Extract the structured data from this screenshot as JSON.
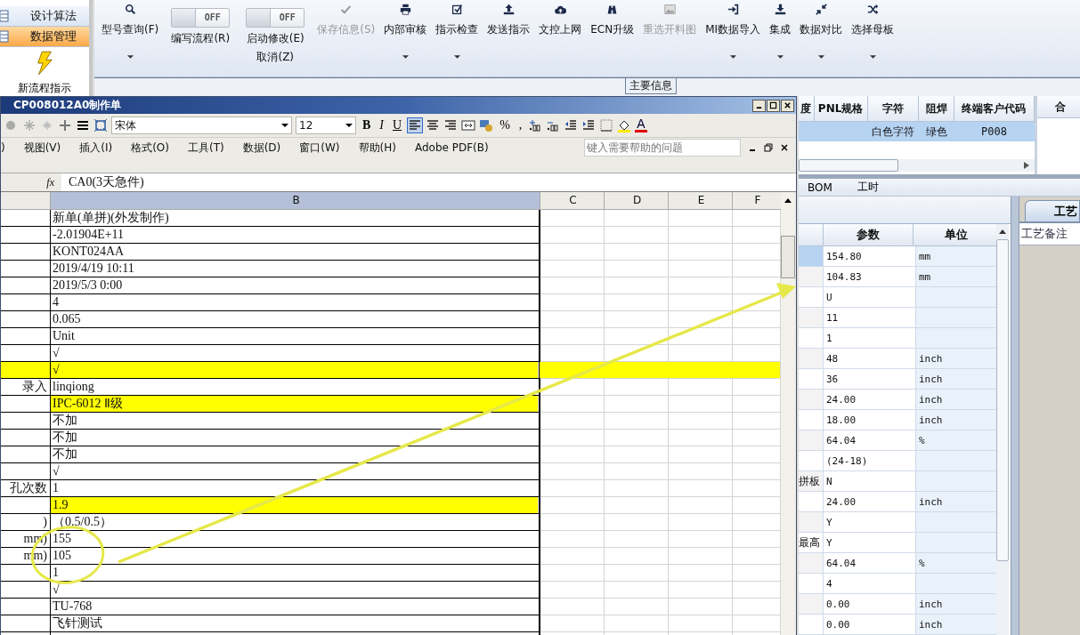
{
  "sidebar": {
    "items": [
      {
        "label": "设计算法",
        "selected": false
      },
      {
        "label": "数据管理",
        "selected": true
      }
    ],
    "shortcut": {
      "label": "新流程指示"
    }
  },
  "ribbon": {
    "buttons": [
      {
        "kind": "button",
        "label": "型号查询(F)",
        "disabled": false,
        "dropdown": true
      },
      {
        "kind": "toggle",
        "label": "编写流程(R)",
        "state": "OFF",
        "on": false
      },
      {
        "kind": "toggle",
        "label": "启动修改(E)",
        "sublabel": "取消(Z)",
        "state": "OFF",
        "on": false
      },
      {
        "kind": "button",
        "label": "保存信息(S)",
        "disabled": true,
        "dropdown": false
      },
      {
        "kind": "button",
        "label": "内部审核",
        "disabled": false,
        "dropdown": true
      },
      {
        "kind": "button",
        "label": "指示检查",
        "disabled": false,
        "dropdown": true
      },
      {
        "kind": "button",
        "label": "发送指示",
        "disabled": false,
        "dropdown": false
      },
      {
        "kind": "button",
        "label": "文控上网",
        "disabled": false,
        "dropdown": false
      },
      {
        "kind": "button",
        "label": "ECN升级",
        "disabled": false,
        "dropdown": false
      },
      {
        "kind": "button",
        "label": "重选开料图",
        "disabled": true,
        "dropdown": false
      },
      {
        "kind": "button",
        "label": "MI数据导入",
        "disabled": false,
        "dropdown": true
      },
      {
        "kind": "button",
        "label": "集成",
        "disabled": false,
        "dropdown": true
      },
      {
        "kind": "button",
        "label": "数据对比",
        "disabled": false,
        "dropdown": true
      },
      {
        "kind": "button",
        "label": "选择母板",
        "disabled": false,
        "dropdown": true
      }
    ],
    "group_label": "主要信息"
  },
  "grid": {
    "columns": [
      "度",
      "PNL规格",
      "字符",
      "阻焊",
      "终端客户代码"
    ],
    "rows": [
      {
        "character": "白色字符",
        "solder_mask": "绿色",
        "end_customer_code": "P008",
        "selected": true
      }
    ]
  },
  "merge_panel": {
    "title": "合"
  },
  "tabs": [
    {
      "label": "BOM",
      "selected": false
    },
    {
      "label": "工时",
      "selected": false
    }
  ],
  "params": {
    "columns": [
      "参数",
      "单位"
    ],
    "rows": [
      {
        "value": "154.80",
        "unit": "mm",
        "selected": true
      },
      {
        "value": "104.83",
        "unit": "mm",
        "selected": false
      },
      {
        "value": "U",
        "selected": false
      },
      {
        "value": "11",
        "selected": false
      },
      {
        "value": "1",
        "selected": false
      },
      {
        "value": "48",
        "unit": "inch",
        "selected": false
      },
      {
        "value": "36",
        "unit": "inch",
        "selected": false
      },
      {
        "value": "24.00",
        "unit": "inch",
        "selected": false
      },
      {
        "value": "18.00",
        "unit": "inch",
        "selected": false
      },
      {
        "value": "64.04",
        "unit": "%",
        "selected": false
      },
      {
        "value": "(24-18)",
        "selected": false
      },
      {
        "name": "拼板",
        "value": "N",
        "selected": false
      },
      {
        "value": "24.00",
        "unit": "inch",
        "selected": false
      },
      {
        "value": "Y",
        "selected": false
      },
      {
        "name": "最高",
        "value": "Y",
        "selected": false
      },
      {
        "value": "64.04",
        "unit": "%",
        "selected": false
      },
      {
        "value": "4",
        "selected": false
      },
      {
        "value": "0.00",
        "unit": "inch",
        "selected": false
      },
      {
        "value": "0.00",
        "unit": "inch",
        "selected": false
      }
    ]
  },
  "notes": {
    "tab": "工艺",
    "label": "工艺备注"
  },
  "excel": {
    "title": "CP008012A0制作单",
    "font": "宋体",
    "size": "12",
    "format_buttons": [
      "B",
      "I",
      "U"
    ],
    "symbols": [
      "%",
      ","
    ],
    "font_color_glyph": "A",
    "menu": [
      ")",
      "视图(V)",
      "插入(I)",
      "格式(O)",
      "工具(T)",
      "数据(D)",
      "窗口(W)",
      "帮助(H)",
      "Adobe PDF(B)"
    ],
    "help_placeholder": "键入需要帮助的问题",
    "function_label": "fx",
    "formula": "CA0(3天急件)",
    "columns": [
      "B",
      "C",
      "D",
      "E",
      "F"
    ],
    "rows": [
      {
        "b": "新单(单拼)(外发制作)",
        "highlighted": false,
        "row_highlighted": false
      },
      {
        "b": "-2.01904E+11",
        "highlighted": false,
        "row_highlighted": false
      },
      {
        "b": "KONT024AA",
        "highlighted": false,
        "row_highlighted": false
      },
      {
        "b": "2019/4/19 10:11",
        "highlighted": false,
        "row_highlighted": false
      },
      {
        "b": "2019/5/3 0:00",
        "highlighted": false,
        "row_highlighted": false
      },
      {
        "b": "4",
        "highlighted": false,
        "row_highlighted": false
      },
      {
        "b": "0.065",
        "highlighted": false,
        "row_highlighted": false
      },
      {
        "b": "Unit",
        "highlighted": false,
        "row_highlighted": false
      },
      {
        "b": "√",
        "highlighted": false,
        "row_highlighted": false
      },
      {
        "b": "√",
        "highlighted": true,
        "row_highlighted": true
      },
      {
        "a": "录入",
        "b": "linqiong",
        "highlighted": false,
        "row_highlighted": false
      },
      {
        "b": "IPC-6012 Ⅱ级",
        "highlighted": true,
        "row_highlighted": false
      },
      {
        "b": "不加",
        "highlighted": false,
        "row_highlighted": false
      },
      {
        "b": "不加",
        "highlighted": false,
        "row_highlighted": false
      },
      {
        "b": "不加",
        "highlighted": false,
        "row_highlighted": false
      },
      {
        "b": "√",
        "highlighted": false,
        "row_highlighted": false
      },
      {
        "a": "孔次数",
        "b": "1",
        "highlighted": false,
        "row_highlighted": false
      },
      {
        "b": "1.9",
        "highlighted": true,
        "row_highlighted": false
      },
      {
        "a": ")",
        "b": "（0.5/0.5）",
        "highlighted": false,
        "row_highlighted": false
      },
      {
        "a": "mm)",
        "b": "155",
        "highlighted": false,
        "row_highlighted": false
      },
      {
        "a": "mm)",
        "b": "105",
        "highlighted": false,
        "row_highlighted": false
      },
      {
        "b": "1",
        "highlighted": false,
        "row_highlighted": false
      },
      {
        "b": "√",
        "highlighted": false,
        "row_highlighted": false
      },
      {
        "b": "TU-768",
        "highlighted": false,
        "row_highlighted": false
      },
      {
        "b": "飞针测试",
        "highlighted": false,
        "row_highlighted": false
      }
    ]
  }
}
